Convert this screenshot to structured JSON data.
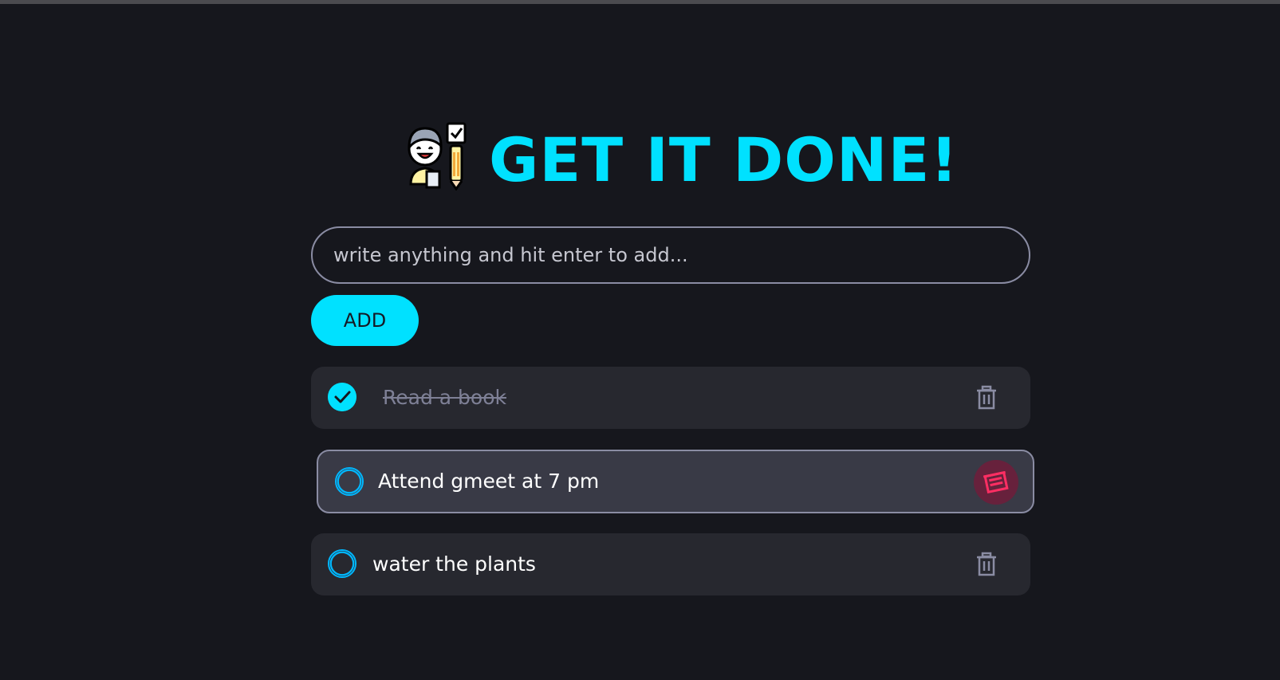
{
  "header": {
    "title": "GET IT DONE!",
    "logo_icon": "kid-with-checklist-icon"
  },
  "input": {
    "placeholder": "write anything and hit enter to add...",
    "value": ""
  },
  "add_button": {
    "label": "ADD"
  },
  "tasks": [
    {
      "text": "Read a book",
      "done": true,
      "delete_hovered": false
    },
    {
      "text": "Attend gmeet at 7 pm",
      "done": false,
      "delete_hovered": true
    },
    {
      "text": "water the plants",
      "done": false,
      "delete_hovered": false
    }
  ],
  "colors": {
    "background": "#16171d",
    "accent": "#00e1ff",
    "task_bg": "#27282f",
    "task_hover_bg": "#393a46",
    "danger": "#ff2e63"
  }
}
